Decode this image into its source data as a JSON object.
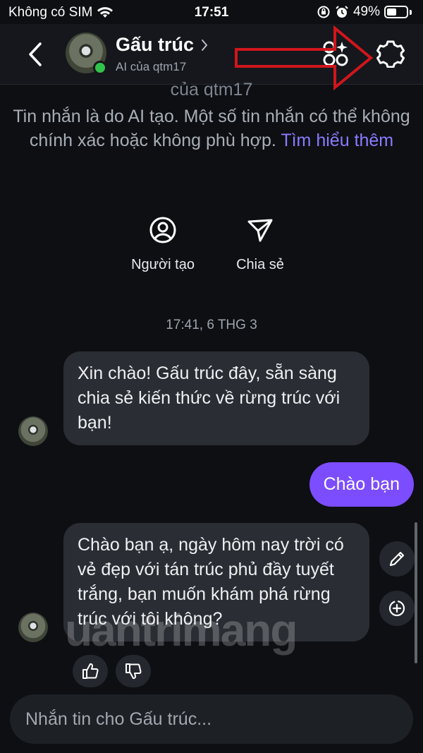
{
  "status_bar": {
    "carrier": "Không có SIM",
    "time": "17:51",
    "battery": "49%",
    "battery_level": 0.49
  },
  "header": {
    "name": "Gấu trúc",
    "subtitle": "AI của qtm17",
    "online_color": "#31c24a"
  },
  "info": {
    "faded_line": "của qtm17",
    "disclaimer": "Tin nhắn là do AI tạo. Một số tin nhắn có thể không chính xác hoặc không phù hợp.",
    "link": "Tìm hiểu thêm"
  },
  "actions": [
    {
      "label": "Người tạo",
      "icon": "person-icon"
    },
    {
      "label": "Chia sẻ",
      "icon": "send-icon"
    }
  ],
  "timestamp": "17:41, 6 THG 3",
  "messages": [
    {
      "from": "ai",
      "text": "Xin chào! Gấu trúc đây, sẵn sàng chia sẻ kiến thức về rừng trúc với bạn!"
    },
    {
      "from": "user",
      "text": "Chào bạn"
    },
    {
      "from": "ai",
      "text": "Chào bạn ạ, ngày hôm nay trời có vẻ đẹp với tán trúc phủ đầy tuyết trắng, bạn muốn khám phá rừng trúc với tôi không?"
    }
  ],
  "watermark": "uantrimang",
  "input": {
    "placeholder": "Nhắn tin cho Gấu trúc..."
  },
  "colors": {
    "accent": "#7c4dff",
    "link": "#8b7bff",
    "annotation": "#d0161c"
  }
}
